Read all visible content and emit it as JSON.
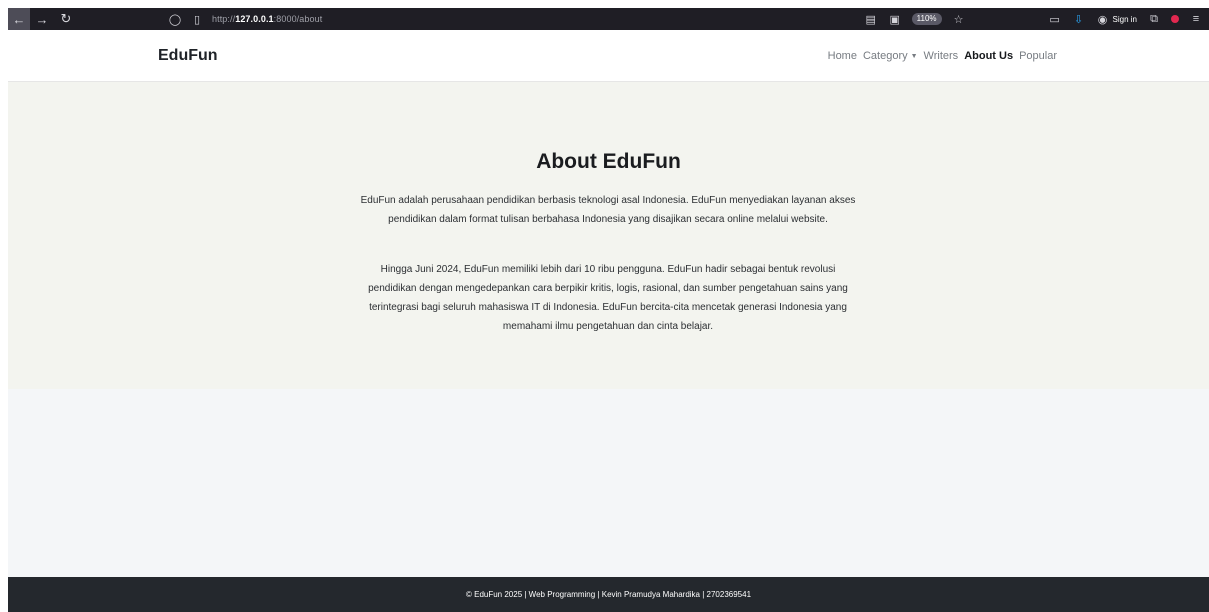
{
  "browser": {
    "url_prefix": "http://",
    "url_host": "127.0.0.1",
    "url_path": ":8000/about",
    "zoom": "110%",
    "sign_in": "Sign in"
  },
  "site": {
    "brand": "EduFun",
    "nav": {
      "home": "Home",
      "category": "Category",
      "writers": "Writers",
      "about": "About Us",
      "popular": "Popular"
    }
  },
  "about": {
    "title": "About EduFun",
    "paragraph_1": "EduFun adalah perusahaan pendidikan berbasis teknologi asal Indonesia. EduFun menyediakan layanan akses pendidikan dalam format tulisan berbahasa Indonesia yang disajikan secara online melalui website.",
    "paragraph_2": "Hingga Juni 2024, EduFun memiliki lebih dari 10 ribu pengguna. EduFun hadir sebagai bentuk revolusi pendidikan dengan mengedepankan cara berpikir kritis, logis, rasional, dan sumber pengetahuan sains yang terintegrasi bagi seluruh mahasiswa IT di Indonesia. EduFun bercita-cita mencetak generasi Indonesia yang memahami ilmu pengetahuan dan cinta belajar."
  },
  "footer": {
    "text": "© EduFun 2025 | Web Programming | Kevin Pramudya Mahardika | 2702369541"
  },
  "icons": {
    "back": "arrow-left-icon",
    "forward": "arrow-right-icon",
    "reload": "reload-icon",
    "shield": "shield-icon",
    "page": "page-icon",
    "reader": "reader-icon",
    "screenshot": "screenshot-icon",
    "star": "star-icon",
    "sidebar": "sidebar-icon",
    "download": "download-icon",
    "account": "account-icon",
    "extensions": "extensions-icon",
    "notification": "notification-icon",
    "menu": "menu-icon"
  },
  "colors": {
    "hero_background": "#f3f4ef",
    "footer_background": "#24282d",
    "active_nav": "#16181b"
  }
}
